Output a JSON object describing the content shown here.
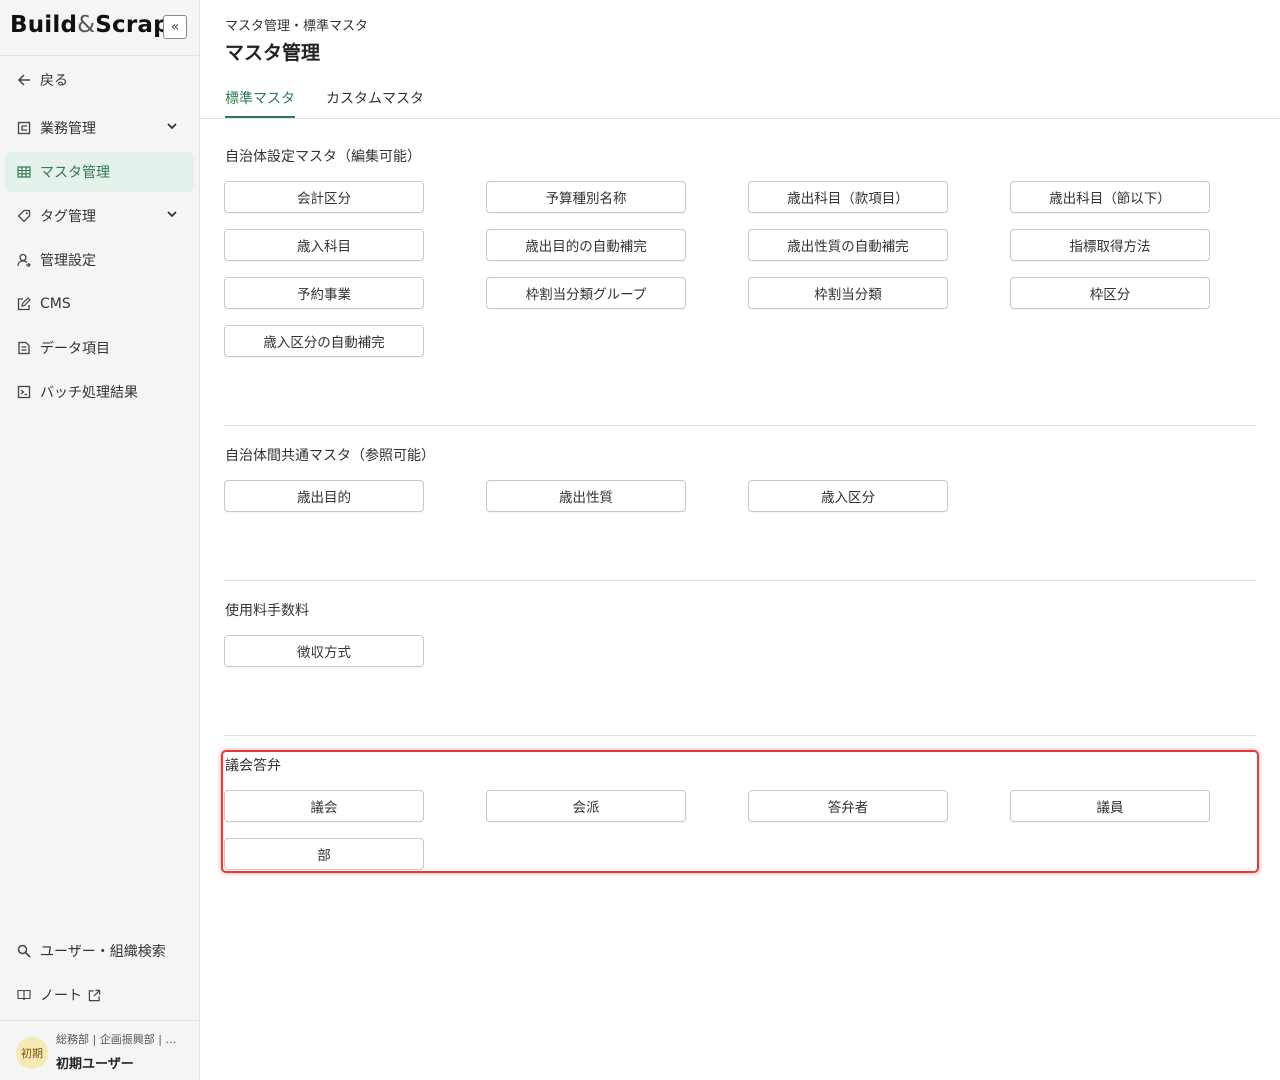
{
  "app": {
    "logo_build": "Build",
    "logo_amp": "&",
    "logo_scrap": "Scrap",
    "collapse_icon": "«"
  },
  "sidebar": {
    "back": "戻る",
    "items": [
      {
        "label": "業務管理",
        "icon": "business-icon",
        "has_chevron": true
      },
      {
        "label": "マスタ管理",
        "icon": "table-icon",
        "active": true
      },
      {
        "label": "タグ管理",
        "icon": "tag-icon",
        "has_chevron": true
      },
      {
        "label": "管理設定",
        "icon": "user-settings-icon"
      },
      {
        "label": "CMS",
        "icon": "edit-icon"
      },
      {
        "label": "データ項目",
        "icon": "document-icon"
      },
      {
        "label": "バッチ処理結果",
        "icon": "terminal-icon"
      }
    ],
    "bottom": [
      {
        "label": "ユーザー・組織検索",
        "icon": "search-icon"
      },
      {
        "label": "ノート",
        "icon": "book-icon"
      }
    ],
    "user": {
      "avatar": "初期",
      "org": "総務部 | 企画振興部 | …",
      "name": "初期ユーザー"
    }
  },
  "header": {
    "breadcrumb": "マスタ管理・標準マスタ",
    "title": "マスタ管理",
    "tabs": [
      {
        "label": "標準マスタ",
        "active": true
      },
      {
        "label": "カスタムマスタ",
        "active": false
      }
    ]
  },
  "sections": [
    {
      "title": "自治体設定マスタ（編集可能）",
      "buttons": [
        "会計区分",
        "予算種別名称",
        "歳出科目（款項目）",
        "歳出科目（節以下）",
        "歳入科目",
        "歳出目的の自動補完",
        "歳出性質の自動補完",
        "指標取得方法",
        "予約事業",
        "枠割当分類グループ",
        "枠割当分類",
        "枠区分",
        "歳入区分の自動補完"
      ]
    },
    {
      "title": "自治体間共通マスタ（参照可能）",
      "buttons": [
        "歳出目的",
        "歳出性質",
        "歳入区分"
      ]
    },
    {
      "title": "使用料手数料",
      "buttons": [
        "徴収方式"
      ]
    },
    {
      "title": "議会答弁",
      "buttons": [
        "議会",
        "会派",
        "答弁者",
        "議員",
        "部"
      ]
    }
  ],
  "colors": {
    "accent": "#2f7a52",
    "active_bg": "#e4f1ea",
    "highlight": "#e23b3b"
  }
}
